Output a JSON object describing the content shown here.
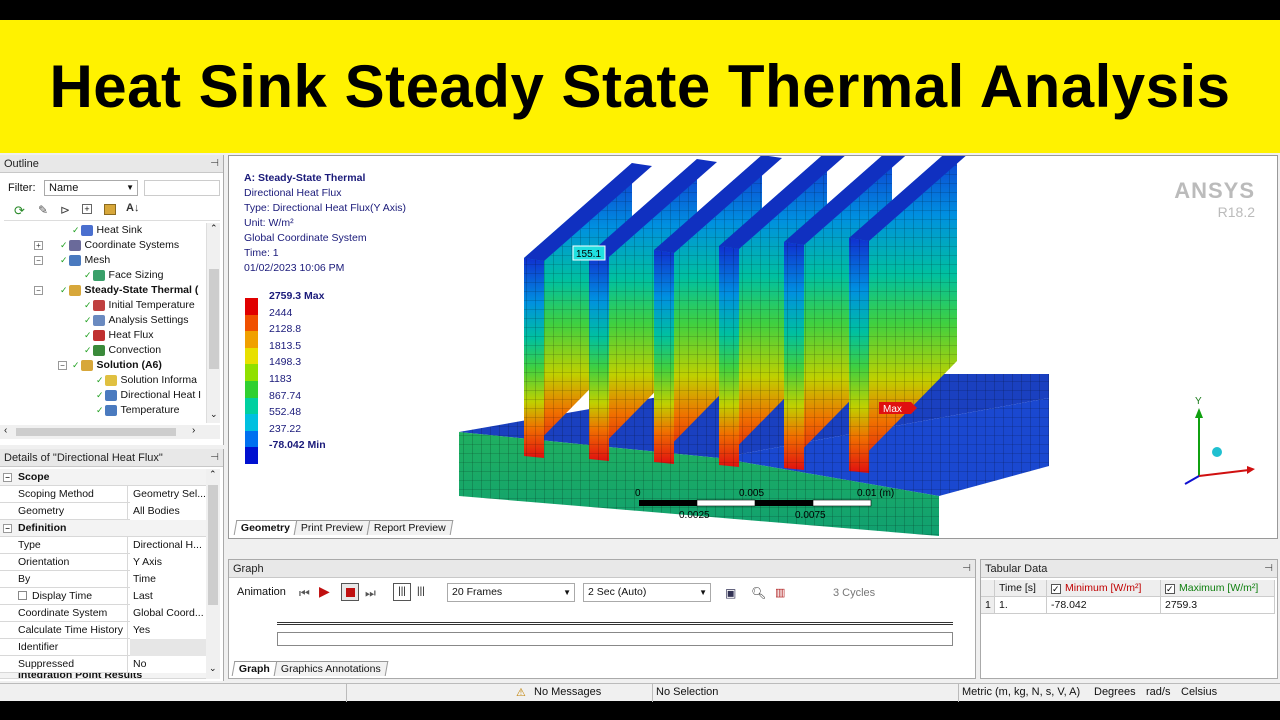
{
  "banner": {
    "title": "Heat Sink Steady State Thermal Analysis"
  },
  "outline": {
    "title": "Outline",
    "filter_label": "Filter:",
    "filter_value": "Name",
    "items": [
      {
        "label": "Heat Sink",
        "bold": false
      },
      {
        "label": "Coordinate Systems",
        "bold": false
      },
      {
        "label": "Mesh",
        "bold": false
      },
      {
        "label": "Face Sizing",
        "bold": false
      },
      {
        "label": "Steady-State Thermal (",
        "bold": true
      },
      {
        "label": "Initial Temperature",
        "bold": false
      },
      {
        "label": "Analysis Settings",
        "bold": false
      },
      {
        "label": "Heat Flux",
        "bold": false
      },
      {
        "label": "Convection",
        "bold": false
      },
      {
        "label": "Solution (A6)",
        "bold": true
      },
      {
        "label": "Solution Informa",
        "bold": false
      },
      {
        "label": "Directional Heat I",
        "bold": false
      },
      {
        "label": "Temperature",
        "bold": false
      }
    ]
  },
  "details": {
    "title": "Details of \"Directional Heat Flux\"",
    "rows": [
      {
        "key": "Scope",
        "value": "",
        "section": true
      },
      {
        "key": "Scoping Method",
        "value": "Geometry Sel..."
      },
      {
        "key": "Geometry",
        "value": "All Bodies"
      },
      {
        "key": "Definition",
        "value": "",
        "section": true
      },
      {
        "key": "Type",
        "value": "Directional H..."
      },
      {
        "key": "Orientation",
        "value": "Y Axis"
      },
      {
        "key": "By",
        "value": "Time"
      },
      {
        "key": "Display Time",
        "value": "Last",
        "checkbox": true
      },
      {
        "key": "Coordinate System",
        "value": "Global Coord..."
      },
      {
        "key": "Calculate Time History",
        "value": "Yes"
      },
      {
        "key": "Identifier",
        "value": ""
      },
      {
        "key": "Suppressed",
        "value": "No"
      }
    ],
    "cut_label": "Integration Point Results"
  },
  "viewport": {
    "info": [
      "A: Steady-State Thermal",
      "Directional Heat Flux",
      "Type: Directional Heat Flux(Y Axis)",
      "Unit: W/m²",
      "Global Coordinate System",
      "Time: 1",
      "01/02/2023 10:06 PM"
    ],
    "legend": [
      {
        "label": "2759.3 Max",
        "color": "#e00000"
      },
      {
        "label": "2444",
        "color": "#f05000"
      },
      {
        "label": "2128.8",
        "color": "#f0a000"
      },
      {
        "label": "1813.5",
        "color": "#e8e000"
      },
      {
        "label": "1498.3",
        "color": "#90e000"
      },
      {
        "label": "1183",
        "color": "#30d030"
      },
      {
        "label": "867.74",
        "color": "#00d0a0"
      },
      {
        "label": "552.48",
        "color": "#00c0e0"
      },
      {
        "label": "237.22",
        "color": "#0070f0"
      },
      {
        "label": "-78.042 Min",
        "color": "#0010d0"
      }
    ],
    "brand": "ANSYS",
    "version": "R18.2",
    "probe_label": "155.1",
    "max_label": "Max",
    "scale_labels": [
      "0",
      "0.005",
      "0.01 (m)",
      "0.0025",
      "0.0075"
    ],
    "triad": {
      "y": "Y"
    },
    "tabs": [
      "Geometry",
      "Print Preview",
      "Report Preview"
    ]
  },
  "graph": {
    "title": "Graph",
    "animation_label": "Animation",
    "frames": "20 Frames",
    "duration": "2 Sec (Auto)",
    "cycles": "3 Cycles",
    "tabs": [
      "Graph",
      "Graphics Annotations"
    ]
  },
  "tabular": {
    "title": "Tabular Data",
    "headers": [
      "Time [s]",
      "Minimum [W/m²]",
      "Maximum [W/m²]"
    ],
    "rows": [
      {
        "index": "1",
        "time": "1.",
        "min": "-78.042",
        "max": "2759.3"
      }
    ]
  },
  "status": {
    "messages": "No Messages",
    "selection": "No Selection",
    "units": "Metric (m, kg, N, s, V, A)",
    "angle": "Degrees",
    "rate": "rad/s",
    "temp": "Celsius"
  }
}
